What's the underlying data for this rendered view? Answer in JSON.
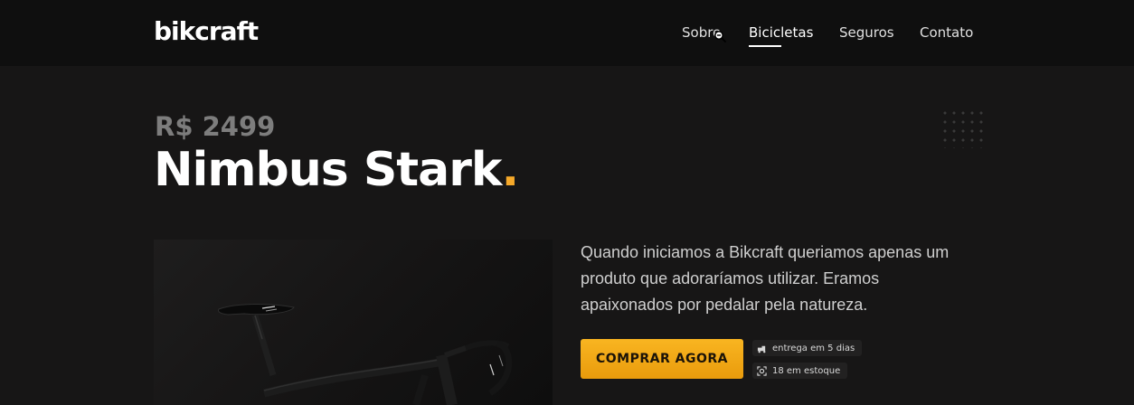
{
  "header": {
    "logo": "bikcraft",
    "nav": [
      {
        "label": "Sobre"
      },
      {
        "label": "Bicicletas"
      },
      {
        "label": "Seguros"
      },
      {
        "label": "Contato"
      }
    ],
    "active_index": 1
  },
  "product": {
    "price": "R$ 2499",
    "name": "Nimbus Stark",
    "name_dot": ".",
    "description": "Quando iniciamos a Bikcraft queriamos apenas um produto que adoraríamos utilizar. Eramos apaixonados por pedalar pela natureza.",
    "buy_label": "COMPRAR AGORA",
    "tags": [
      {
        "icon": "delivery-icon",
        "label": "entrega em 5 dias"
      },
      {
        "icon": "stock-icon",
        "label": "18 em estoque"
      }
    ]
  },
  "colors": {
    "accent": "#f6a92a",
    "background": "#171616",
    "header": "#0f0f0f"
  }
}
